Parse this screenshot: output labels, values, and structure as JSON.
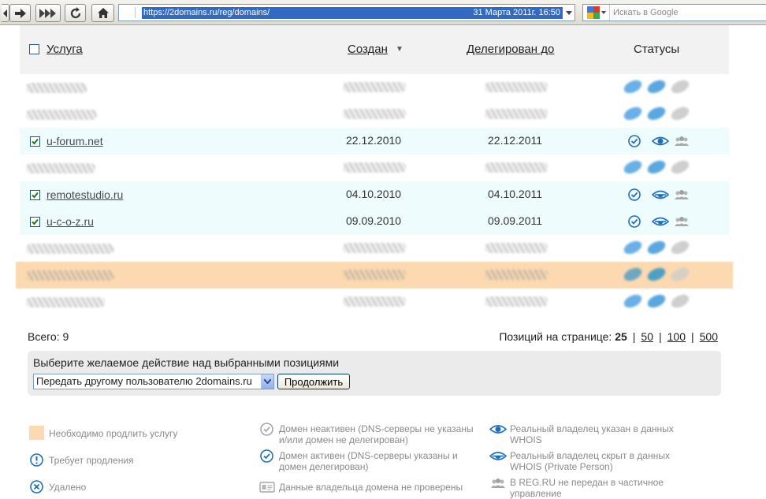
{
  "browser": {
    "url": "https://2domains.ru/reg/domains/",
    "date": "31 Марта 2011г. 16:50",
    "search_placeholder": "Искать в Google"
  },
  "table": {
    "headers": {
      "service": "Услуга",
      "created": "Создан",
      "delegated": "Делегирован до",
      "statuses": "Статусы"
    },
    "sort_indicator": "▼",
    "rows": [
      {
        "domain": "u-forum.net",
        "created": "22.12.2010",
        "delegated": "22.12.2011"
      },
      {
        "domain": "remotestudio.ru",
        "created": "04.10.2010",
        "delegated": "04.10.2011"
      },
      {
        "domain": "u-c-o-z.ru",
        "created": "09.09.2010",
        "delegated": "09.09.2011"
      }
    ]
  },
  "summary": {
    "total": "Всего: 9",
    "per_page_label": "Позиций на странице:",
    "per_page_current": "25",
    "per_page_options": [
      "50",
      "100",
      "500"
    ]
  },
  "actions": {
    "title": "Выберите желаемое действие над выбранными позициями",
    "selected_action": "Передать другому пользователю 2domains.ru",
    "button_label": "Продолжить"
  },
  "legend": {
    "renew_needed": "Необходимо продлить услугу",
    "requires_renewal": "Требует продления",
    "deleted": "Удалено",
    "domain_inactive": "Домен неактивен (DNS-серверы не указаны и/или домен не делегирован)",
    "domain_active": "Домен активен (DNS-серверы указаны и домен делегирован)",
    "owner_not_verified": "Данные владельца домена не проверены",
    "owner_in_whois": "Реальный владелец указан в данных WHOIS",
    "owner_hidden": "Реальный владелец скрыт в данных WHOIS (Private Person)",
    "not_transferred": "В REG.RU не передан в частичное управление"
  },
  "colors": {
    "accent_blue": "#1f6fb8",
    "highlight_row": "#eefcfe",
    "renew_orange": "#fcd9b0",
    "url_selection": "#316ac5"
  }
}
